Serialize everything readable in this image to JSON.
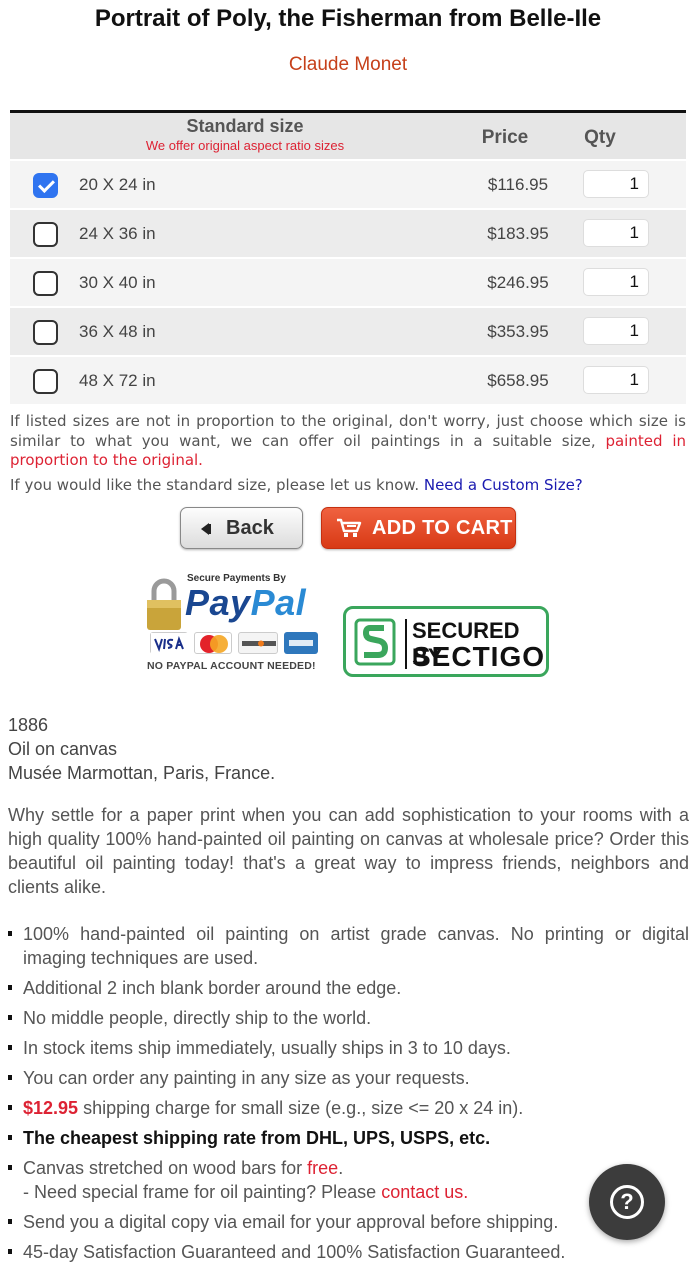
{
  "product": {
    "title": "Portrait of Poly, the Fisherman from Belle-Ile",
    "artist": "Claude Monet"
  },
  "size_table": {
    "header": {
      "size_title": "Standard size",
      "size_subtitle": "We offer original aspect ratio sizes",
      "price": "Price",
      "qty": "Qty"
    },
    "rows": [
      {
        "size": "20 X 24 in",
        "price": "$116.95",
        "qty": "1",
        "checked": true
      },
      {
        "size": "24 X 36 in",
        "price": "$183.95",
        "qty": "1",
        "checked": false
      },
      {
        "size": "30 X 40 in",
        "price": "$246.95",
        "qty": "1",
        "checked": false
      },
      {
        "size": "36 X 48 in",
        "price": "$353.95",
        "qty": "1",
        "checked": false
      },
      {
        "size": "48 X 72 in",
        "price": "$658.95",
        "qty": "1",
        "checked": false
      }
    ]
  },
  "notes": {
    "proportion_text": "If listed sizes are not in proportion to the original, don't worry, just choose which size is similar to what you want, we can offer oil paintings in a suitable size, ",
    "proportion_red": "painted in proportion to the original.",
    "standard_text": "If you would like the standard size, please let us know. ",
    "custom_link": "Need a Custom Size?"
  },
  "buttons": {
    "back": "Back",
    "add_to_cart": "ADD TO CART"
  },
  "badges": {
    "paypal_secure": "Secure Payments By",
    "paypal_logo_a": "Pay",
    "paypal_logo_b": "Pal",
    "paypal_note": "NO PAYPAL ACCOUNT NEEDED!",
    "sectigo_line1": "SECURED BY",
    "sectigo_line2": "SECTIGO"
  },
  "details": {
    "year": "1886",
    "medium": "Oil on canvas",
    "location": "Musée Marmottan, Paris, France."
  },
  "intro": "Why settle for a paper print when you can add sophistication to your rooms with a high quality 100% hand-painted oil painting on canvas at wholesale price? Order this beautiful oil painting today! that's a great way to impress friends, neighbors and clients alike.",
  "features": {
    "f1": "100% hand-painted oil painting on artist grade canvas. No printing or digital imaging techniques are used.",
    "f2": "Additional 2 inch blank border around the edge.",
    "f3": "No middle people, directly ship to the world.",
    "f4": "In stock items ship immediately, usually ships in 3 to 10 days.",
    "f5": "You can order any painting in any size as your requests.",
    "f6_price": "$12.95",
    "f6_text": " shipping charge for small size (e.g., size <= 20 x 24 in).",
    "f7": "The cheapest shipping rate from DHL, UPS, USPS, etc.",
    "f8_text": "Canvas stretched on wood bars for ",
    "f8_free": "free",
    "f8_end": ".",
    "f8_sub_text": "- Need special frame for oil painting? Please ",
    "f8_sub_link": "contact us.",
    "f9": "Send you a digital copy via email for your approval before shipping.",
    "f10": "45-day Satisfaction Guaranteed and 100% Satisfaction Guaranteed."
  },
  "help": {
    "icon": "?"
  },
  "colors": {
    "accent_red": "#d23",
    "cart_button": "#e24a25",
    "checkbox_blue": "#2f74f0",
    "link_blue": "#1a1ab0",
    "sectigo_green": "#3aa65c"
  }
}
